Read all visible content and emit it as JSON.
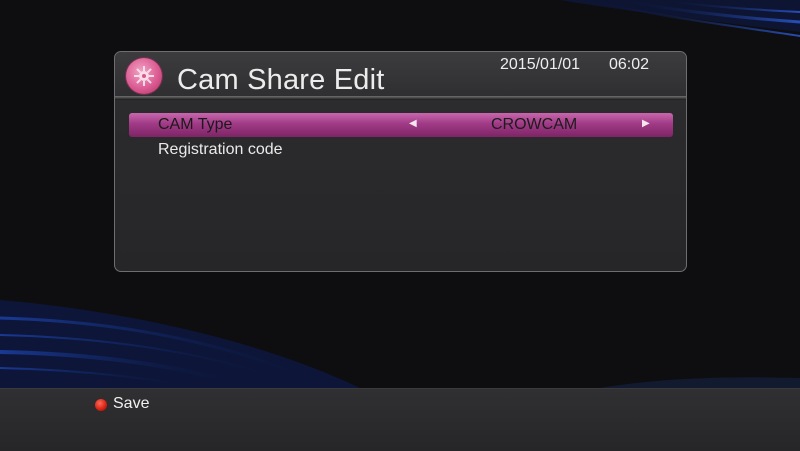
{
  "header": {
    "title": "Cam Share Edit",
    "date": "2015/01/01",
    "time": "06:02",
    "icon": "gear-icon"
  },
  "settings": [
    {
      "label": "CAM Type",
      "value": "CROWCAM",
      "selected": true
    },
    {
      "label": "Registration code",
      "value": "",
      "selected": false
    }
  ],
  "footer": {
    "save_label": "Save",
    "save_color": "#e0301e"
  },
  "colors": {
    "highlight": "#b54d98",
    "background": "#0e0e10",
    "panel": "#2c2c2e"
  }
}
